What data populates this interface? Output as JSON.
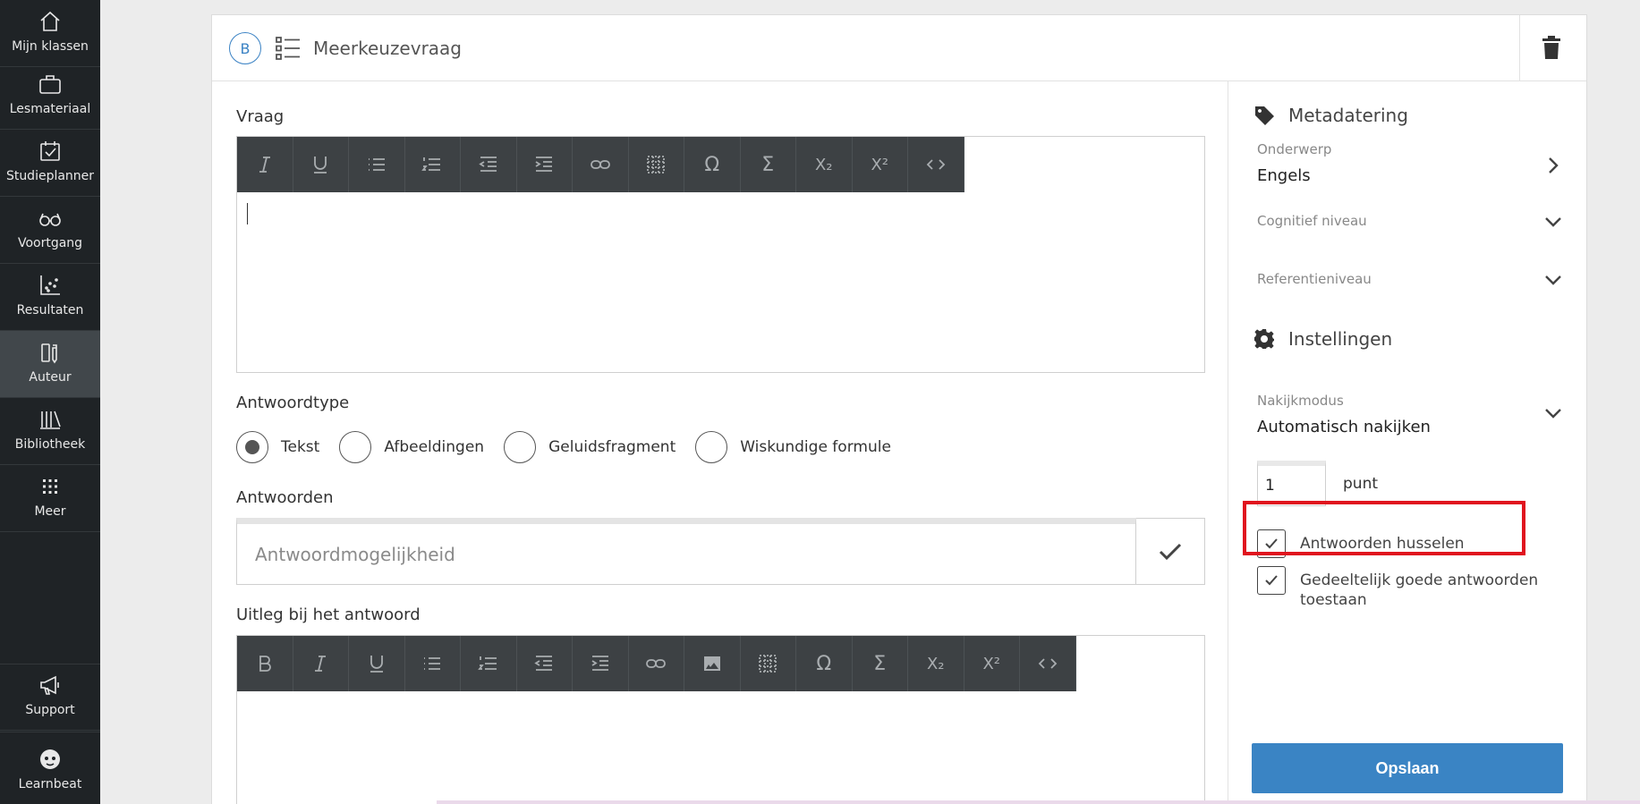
{
  "sidebar": {
    "items": [
      {
        "label": "Mijn klassen",
        "icon": "home-icon"
      },
      {
        "label": "Lesmateriaal",
        "icon": "briefcase-icon"
      },
      {
        "label": "Studieplanner",
        "icon": "calendar-check-icon"
      },
      {
        "label": "Voortgang",
        "icon": "glasses-icon"
      },
      {
        "label": "Resultaten",
        "icon": "scatter-chart-icon"
      },
      {
        "label": "Auteur",
        "icon": "pencil-book-icon",
        "active": true
      },
      {
        "label": "Bibliotheek",
        "icon": "library-icon"
      },
      {
        "label": "Meer",
        "icon": "grid-icon"
      }
    ],
    "bottom": [
      {
        "label": "Support",
        "icon": "megaphone-icon"
      },
      {
        "label": "Learnbeat",
        "icon": "mascot-icon"
      }
    ]
  },
  "header": {
    "badge": "B",
    "title": "Meerkeuzevraag"
  },
  "main": {
    "question_label": "Vraag",
    "answer_type_label": "Antwoordtype",
    "answer_types": [
      "Tekst",
      "Afbeeldingen",
      "Geluidsfragment",
      "Wiskundige formule"
    ],
    "answers_label": "Antwoorden",
    "answer_placeholder": "Antwoordmogelijkheid",
    "explanation_label": "Uitleg bij het antwoord",
    "omega": "Ω",
    "sigma": "Σ",
    "subscript": "X₂",
    "superscript": "X²"
  },
  "metadata": {
    "heading": "Metadatering",
    "subject_label": "Onderwerp",
    "subject_value": "Engels",
    "cognitive_label": "Cognitief niveau",
    "reference_label": "Referentieniveau"
  },
  "settings": {
    "heading": "Instellingen",
    "grading_label": "Nakijkmodus",
    "grading_value": "Automatisch nakijken",
    "points_value": "1",
    "points_label": "punt",
    "shuffle_label": "Antwoorden husselen",
    "partial_label": "Gedeeltelijk goede antwoorden toestaan",
    "save_label": "Opslaan"
  },
  "colors": {
    "sidebar_bg": "#1f2326",
    "accent": "#3a84c4",
    "highlight": "#e0141e",
    "toolbar_bg": "#3d4144"
  }
}
